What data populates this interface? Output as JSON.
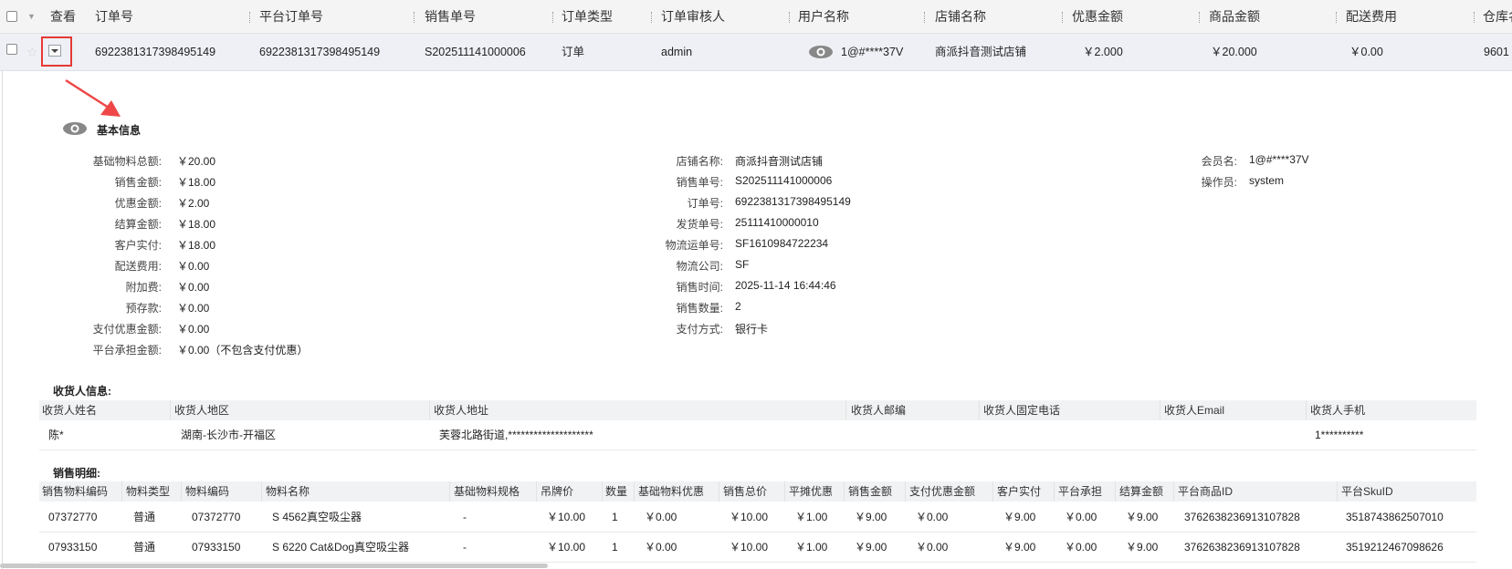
{
  "header": {
    "columns": [
      "查看",
      "订单号",
      "平台订单号",
      "销售单号",
      "订单类型",
      "订单审核人",
      "用户名称",
      "店铺名称",
      "优惠金额",
      "商品金额",
      "配送费用",
      "仓库名"
    ]
  },
  "order_row": {
    "order_no": "6922381317398495149",
    "platform_order_no": "6922381317398495149",
    "sales_no": "S202511141000006",
    "order_type": "订单",
    "reviewer": "admin",
    "user_name": "1@#****37V",
    "shop_name": "商派抖音测试店铺",
    "discount": "￥2.000",
    "goods_amount": "￥20.000",
    "shipping_fee": "￥0.00",
    "warehouse": "9601"
  },
  "basic": {
    "title": "基本信息",
    "left": [
      {
        "label": "基础物料总额:",
        "value": "￥20.00"
      },
      {
        "label": "销售金额:",
        "value": "￥18.00"
      },
      {
        "label": "优惠金额:",
        "value": "￥2.00"
      },
      {
        "label": "结算金额:",
        "value": "￥18.00"
      },
      {
        "label": "客户实付:",
        "value": "￥18.00"
      },
      {
        "label": "配送费用:",
        "value": "￥0.00"
      },
      {
        "label": "附加费:",
        "value": "￥0.00"
      },
      {
        "label": "预存款:",
        "value": "￥0.00"
      },
      {
        "label": "支付优惠金额:",
        "value": "￥0.00"
      },
      {
        "label": "平台承担金额:",
        "value": "￥0.00（不包含支付优惠）"
      }
    ],
    "middle": [
      {
        "label": "店铺名称:",
        "value": "商派抖音测试店铺"
      },
      {
        "label": "销售单号:",
        "value": "S202511141000006"
      },
      {
        "label": "订单号:",
        "value": "6922381317398495149"
      },
      {
        "label": "发货单号:",
        "value": "25111410000010"
      },
      {
        "label": "物流运单号:",
        "value": "SF1610984722234"
      },
      {
        "label": "物流公司:",
        "value": "SF"
      },
      {
        "label": "销售时间:",
        "value": "2025-11-14 16:44:46"
      },
      {
        "label": "销售数量:",
        "value": "2"
      },
      {
        "label": "支付方式:",
        "value": "银行卡"
      }
    ],
    "right": [
      {
        "label": "会员名:",
        "value": "1@#****37V"
      },
      {
        "label": "操作员:",
        "value": "system"
      }
    ]
  },
  "receiver": {
    "title": "收货人信息:",
    "headers": [
      "收货人姓名",
      "收货人地区",
      "收货人地址",
      "收货人邮编",
      "收货人固定电话",
      "收货人Email",
      "收货人手机"
    ],
    "row": [
      "陈*",
      "湖南-长沙市-开福区",
      "芙蓉北路街道,********************",
      "",
      "",
      "",
      "1**********"
    ]
  },
  "sales_detail": {
    "title": "销售明细:",
    "headers": [
      "销售物料编码",
      "物料类型",
      "物料编码",
      "物料名称",
      "基础物料规格",
      "吊牌价",
      "数量",
      "基础物料优惠",
      "销售总价",
      "平摊优惠",
      "销售金额",
      "支付优惠金额",
      "客户实付",
      "平台承担",
      "结算金额",
      "平台商品ID",
      "平台SkuID"
    ],
    "rows": [
      [
        "07372770",
        "普通",
        "07372770",
        "S 4562真空吸尘器",
        "-",
        "￥10.00",
        "1",
        "￥0.00",
        "￥10.00",
        "￥1.00",
        "￥9.00",
        "￥0.00",
        "￥9.00",
        "￥0.00",
        "￥9.00",
        "3762638236913107828",
        "3518743862507010"
      ],
      [
        "07933150",
        "普通",
        "07933150",
        "S 6220 Cat&Dog真空吸尘器",
        "-",
        "￥10.00",
        "1",
        "￥0.00",
        "￥10.00",
        "￥1.00",
        "￥9.00",
        "￥0.00",
        "￥9.00",
        "￥0.00",
        "￥9.00",
        "3762638236913107828",
        "3519212467098626"
      ]
    ]
  },
  "colors": {
    "highlight": "#e53935",
    "arrow": "#ef4747",
    "row_bg": "#eef0f5",
    "header_bg": "#f4f4f4"
  }
}
